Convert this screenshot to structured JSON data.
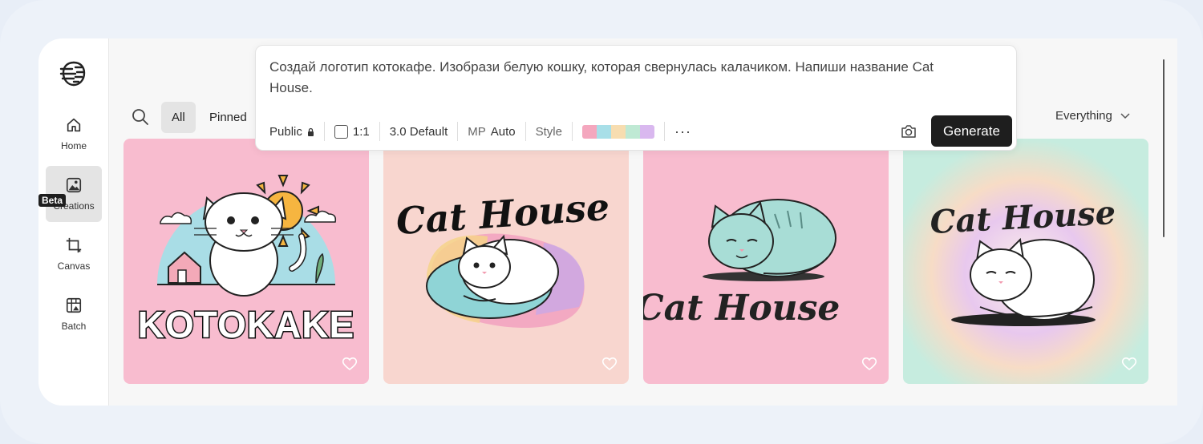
{
  "sidebar": {
    "items": [
      {
        "label": "Home",
        "icon": "home-icon"
      },
      {
        "label": "Creations",
        "icon": "image-icon",
        "active": true
      },
      {
        "label": "Canvas",
        "icon": "crop-icon",
        "badge": "Beta"
      },
      {
        "label": "Batch",
        "icon": "batch-icon"
      }
    ]
  },
  "filters": {
    "all": "All",
    "pinned": "Pinned",
    "everything": "Everything"
  },
  "prompt": {
    "text": "Создай логотип котокафе. Изобрази белую кошку, которая свернулась калачиком. Напиши название Cat House.",
    "visibility": "Public",
    "ratio": "1:1",
    "model": "3.0 Default",
    "mp_label": "MP",
    "mp_value": "Auto",
    "style": "Style",
    "more": "···",
    "generate": "Generate",
    "palette": [
      "#f4a7be",
      "#a8dfe8",
      "#f7ddb0",
      "#bfe9d4",
      "#d9b8ef"
    ]
  },
  "cards": [
    {
      "title_art": "KOTOKAKE",
      "bg": "#f8bccf"
    },
    {
      "title_art": "Cat House",
      "bg": "#f8d6cf"
    },
    {
      "title_art": "Cat House",
      "bg": "#f8bccf"
    },
    {
      "title_art": "Cat House",
      "bg": "#c6ecdf"
    }
  ]
}
